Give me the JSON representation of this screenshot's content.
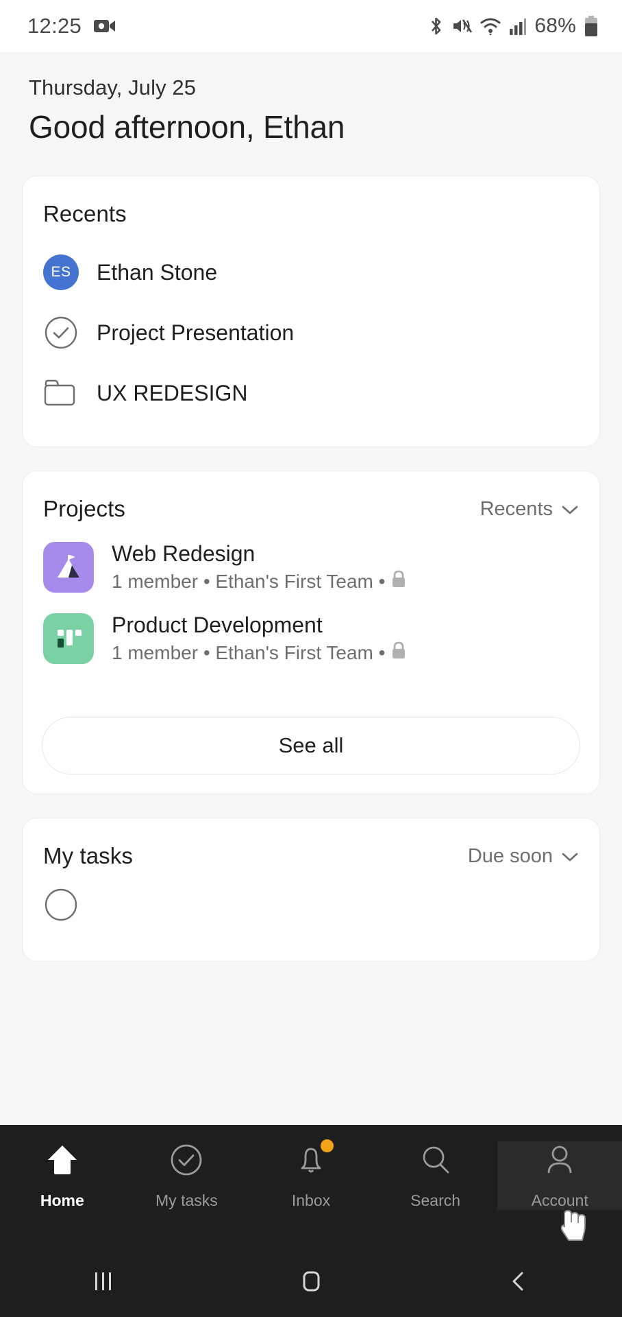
{
  "statusbar": {
    "time": "12:25",
    "battery_pct": "68%",
    "icons": [
      "video-camera-icon",
      "bluetooth-icon",
      "mute-icon",
      "wifi-icon",
      "cellular-signal-icon",
      "battery-icon"
    ]
  },
  "greeting": {
    "date": "Thursday, July 25",
    "message": "Good afternoon, Ethan"
  },
  "recents": {
    "title": "Recents",
    "items": [
      {
        "label": "Ethan Stone",
        "icon": "avatar",
        "initials": "ES",
        "color": "#4573D2"
      },
      {
        "label": "Project Presentation",
        "icon": "check-circle-icon"
      },
      {
        "label": "UX REDESIGN",
        "icon": "folder-icon"
      }
    ]
  },
  "projects": {
    "title": "Projects",
    "filter": "Recents",
    "see_all": "See all",
    "items": [
      {
        "name": "Web Redesign",
        "meta": "1 member • Ethan's First Team •",
        "icon": "mountain-flag-icon",
        "color": "#A78BEA",
        "privacy": "lock-icon"
      },
      {
        "name": "Product Development",
        "meta": "1 member • Ethan's First Team •",
        "icon": "board-columns-icon",
        "color": "#79D1A4",
        "privacy": "lock-icon"
      }
    ]
  },
  "my_tasks": {
    "title": "My tasks",
    "filter": "Due soon"
  },
  "bottom_nav": {
    "items": [
      {
        "label": "Home",
        "icon": "home-icon",
        "active": true
      },
      {
        "label": "My tasks",
        "icon": "check-circle-icon",
        "active": false
      },
      {
        "label": "Inbox",
        "icon": "bell-icon",
        "active": false,
        "badge": true
      },
      {
        "label": "Search",
        "icon": "search-icon",
        "active": false
      },
      {
        "label": "Account",
        "icon": "person-icon",
        "active": false
      }
    ]
  },
  "system_nav": {
    "recents": "recents-icon",
    "home": "home-square-icon",
    "back": "back-chevron-icon"
  }
}
